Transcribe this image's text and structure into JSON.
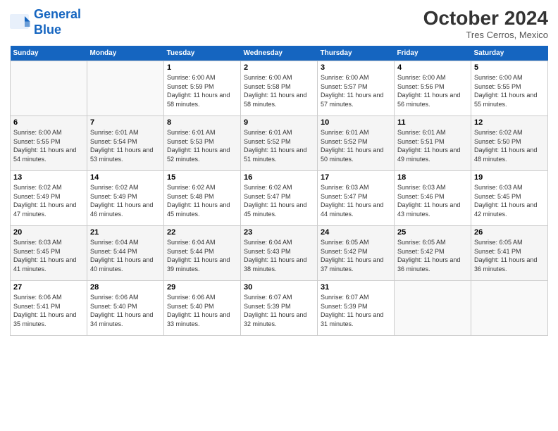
{
  "header": {
    "logo_line1": "General",
    "logo_line2": "Blue",
    "month_title": "October 2024",
    "location": "Tres Cerros, Mexico"
  },
  "weekdays": [
    "Sunday",
    "Monday",
    "Tuesday",
    "Wednesday",
    "Thursday",
    "Friday",
    "Saturday"
  ],
  "weeks": [
    [
      {
        "day": "",
        "info": ""
      },
      {
        "day": "",
        "info": ""
      },
      {
        "day": "1",
        "info": "Sunrise: 6:00 AM\nSunset: 5:59 PM\nDaylight: 11 hours and 58 minutes."
      },
      {
        "day": "2",
        "info": "Sunrise: 6:00 AM\nSunset: 5:58 PM\nDaylight: 11 hours and 58 minutes."
      },
      {
        "day": "3",
        "info": "Sunrise: 6:00 AM\nSunset: 5:57 PM\nDaylight: 11 hours and 57 minutes."
      },
      {
        "day": "4",
        "info": "Sunrise: 6:00 AM\nSunset: 5:56 PM\nDaylight: 11 hours and 56 minutes."
      },
      {
        "day": "5",
        "info": "Sunrise: 6:00 AM\nSunset: 5:55 PM\nDaylight: 11 hours and 55 minutes."
      }
    ],
    [
      {
        "day": "6",
        "info": "Sunrise: 6:00 AM\nSunset: 5:55 PM\nDaylight: 11 hours and 54 minutes."
      },
      {
        "day": "7",
        "info": "Sunrise: 6:01 AM\nSunset: 5:54 PM\nDaylight: 11 hours and 53 minutes."
      },
      {
        "day": "8",
        "info": "Sunrise: 6:01 AM\nSunset: 5:53 PM\nDaylight: 11 hours and 52 minutes."
      },
      {
        "day": "9",
        "info": "Sunrise: 6:01 AM\nSunset: 5:52 PM\nDaylight: 11 hours and 51 minutes."
      },
      {
        "day": "10",
        "info": "Sunrise: 6:01 AM\nSunset: 5:52 PM\nDaylight: 11 hours and 50 minutes."
      },
      {
        "day": "11",
        "info": "Sunrise: 6:01 AM\nSunset: 5:51 PM\nDaylight: 11 hours and 49 minutes."
      },
      {
        "day": "12",
        "info": "Sunrise: 6:02 AM\nSunset: 5:50 PM\nDaylight: 11 hours and 48 minutes."
      }
    ],
    [
      {
        "day": "13",
        "info": "Sunrise: 6:02 AM\nSunset: 5:49 PM\nDaylight: 11 hours and 47 minutes."
      },
      {
        "day": "14",
        "info": "Sunrise: 6:02 AM\nSunset: 5:49 PM\nDaylight: 11 hours and 46 minutes."
      },
      {
        "day": "15",
        "info": "Sunrise: 6:02 AM\nSunset: 5:48 PM\nDaylight: 11 hours and 45 minutes."
      },
      {
        "day": "16",
        "info": "Sunrise: 6:02 AM\nSunset: 5:47 PM\nDaylight: 11 hours and 45 minutes."
      },
      {
        "day": "17",
        "info": "Sunrise: 6:03 AM\nSunset: 5:47 PM\nDaylight: 11 hours and 44 minutes."
      },
      {
        "day": "18",
        "info": "Sunrise: 6:03 AM\nSunset: 5:46 PM\nDaylight: 11 hours and 43 minutes."
      },
      {
        "day": "19",
        "info": "Sunrise: 6:03 AM\nSunset: 5:45 PM\nDaylight: 11 hours and 42 minutes."
      }
    ],
    [
      {
        "day": "20",
        "info": "Sunrise: 6:03 AM\nSunset: 5:45 PM\nDaylight: 11 hours and 41 minutes."
      },
      {
        "day": "21",
        "info": "Sunrise: 6:04 AM\nSunset: 5:44 PM\nDaylight: 11 hours and 40 minutes."
      },
      {
        "day": "22",
        "info": "Sunrise: 6:04 AM\nSunset: 5:44 PM\nDaylight: 11 hours and 39 minutes."
      },
      {
        "day": "23",
        "info": "Sunrise: 6:04 AM\nSunset: 5:43 PM\nDaylight: 11 hours and 38 minutes."
      },
      {
        "day": "24",
        "info": "Sunrise: 6:05 AM\nSunset: 5:42 PM\nDaylight: 11 hours and 37 minutes."
      },
      {
        "day": "25",
        "info": "Sunrise: 6:05 AM\nSunset: 5:42 PM\nDaylight: 11 hours and 36 minutes."
      },
      {
        "day": "26",
        "info": "Sunrise: 6:05 AM\nSunset: 5:41 PM\nDaylight: 11 hours and 36 minutes."
      }
    ],
    [
      {
        "day": "27",
        "info": "Sunrise: 6:06 AM\nSunset: 5:41 PM\nDaylight: 11 hours and 35 minutes."
      },
      {
        "day": "28",
        "info": "Sunrise: 6:06 AM\nSunset: 5:40 PM\nDaylight: 11 hours and 34 minutes."
      },
      {
        "day": "29",
        "info": "Sunrise: 6:06 AM\nSunset: 5:40 PM\nDaylight: 11 hours and 33 minutes."
      },
      {
        "day": "30",
        "info": "Sunrise: 6:07 AM\nSunset: 5:39 PM\nDaylight: 11 hours and 32 minutes."
      },
      {
        "day": "31",
        "info": "Sunrise: 6:07 AM\nSunset: 5:39 PM\nDaylight: 11 hours and 31 minutes."
      },
      {
        "day": "",
        "info": ""
      },
      {
        "day": "",
        "info": ""
      }
    ]
  ]
}
